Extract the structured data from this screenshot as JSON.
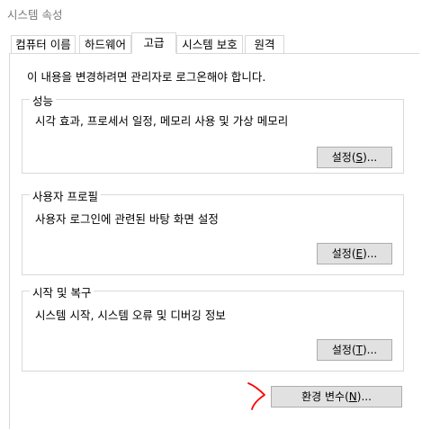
{
  "window": {
    "title": "시스템 속성"
  },
  "tabs": [
    {
      "label": "컴퓨터 이름"
    },
    {
      "label": "하드웨어"
    },
    {
      "label": "고급"
    },
    {
      "label": "시스템 보호"
    },
    {
      "label": "원격"
    }
  ],
  "notice": "이 내용을 변경하려면 관리자로 로그온해야 합니다.",
  "groups": {
    "performance": {
      "title": "성능",
      "description": "시각 효과, 프로세서 일정, 메모리 사용 및 가상 메모리",
      "button": {
        "text": "설정(",
        "key": "S",
        "suffix": ")..."
      }
    },
    "user_profiles": {
      "title": "사용자 프로필",
      "description": "사용자 로그인에 관련된 바탕 화면 설정",
      "button": {
        "text": "설정(",
        "key": "E",
        "suffix": ")..."
      }
    },
    "startup_recovery": {
      "title": "시작 및 복구",
      "description": "시스템 시작, 시스템 오류 및 디버깅 정보",
      "button": {
        "text": "설정(",
        "key": "T",
        "suffix": ")..."
      }
    }
  },
  "env_button": {
    "text": "환경 변수(",
    "key": "N",
    "suffix": ")..."
  },
  "colors": {
    "annotation": "#ff0000",
    "button_bg": "#e1e1e1",
    "border": "#d9d9d9"
  }
}
